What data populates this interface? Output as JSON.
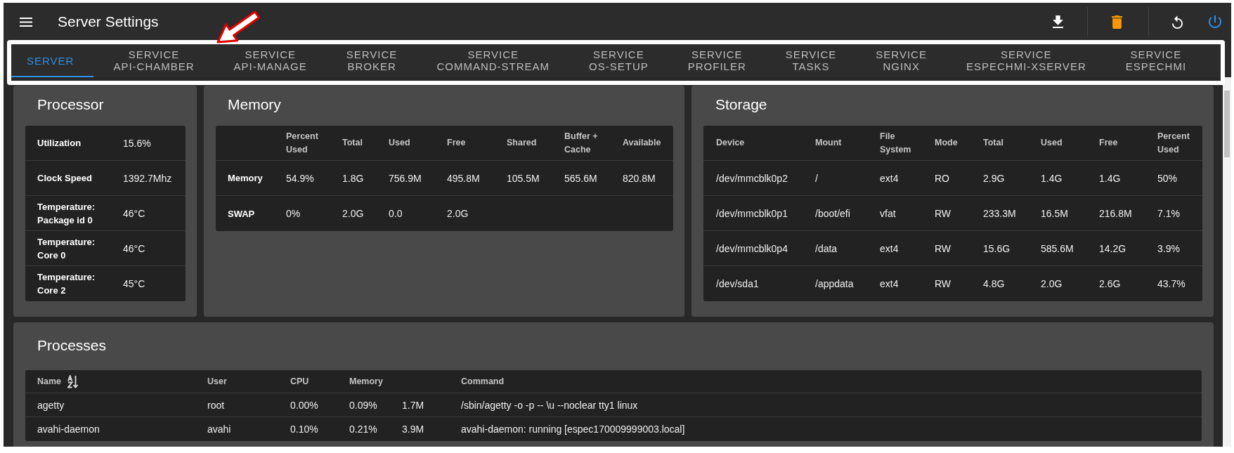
{
  "app_bar": {
    "title": "Server Settings"
  },
  "tabs": [
    {
      "label": "SERVER",
      "selected": true
    },
    {
      "label": "SERVICE\nAPI-CHAMBER",
      "selected": false
    },
    {
      "label": "SERVICE\nAPI-MANAGE",
      "selected": false
    },
    {
      "label": "SERVICE\nBROKER",
      "selected": false
    },
    {
      "label": "SERVICE\nCOMMAND-STREAM",
      "selected": false
    },
    {
      "label": "SERVICE\nOS-SETUP",
      "selected": false
    },
    {
      "label": "SERVICE\nPROFILER",
      "selected": false
    },
    {
      "label": "SERVICE\nTASKS",
      "selected": false
    },
    {
      "label": "SERVICE\nNGINX",
      "selected": false
    },
    {
      "label": "SERVICE\nESPECHMI-XSERVER",
      "selected": false
    },
    {
      "label": "SERVICE\nESPECHMI",
      "selected": false
    }
  ],
  "processor": {
    "title": "Processor",
    "rows": [
      {
        "label": "Utilization",
        "value": "15.6%"
      },
      {
        "label": "Clock Speed",
        "value": "1392.7Mhz"
      },
      {
        "label": "Temperature: Package id 0",
        "value": "46°C"
      },
      {
        "label": "Temperature: Core 0",
        "value": "46°C"
      },
      {
        "label": "Temperature: Core 2",
        "value": "45°C"
      }
    ]
  },
  "memory": {
    "title": "Memory",
    "columns": [
      "Percent Used",
      "Total",
      "Used",
      "Free",
      "Shared",
      "Buffer + Cache",
      "Available"
    ],
    "rows": [
      {
        "label": "Memory",
        "values": [
          "54.9%",
          "1.8G",
          "756.9M",
          "495.8M",
          "105.5M",
          "565.6M",
          "820.8M"
        ]
      },
      {
        "label": "SWAP",
        "values": [
          "0%",
          "2.0G",
          "0.0",
          "2.0G"
        ]
      }
    ]
  },
  "storage": {
    "title": "Storage",
    "columns": [
      "Device",
      "Mount",
      "File System",
      "Mode",
      "Total",
      "Used",
      "Free",
      "Percent Used"
    ],
    "rows": [
      {
        "cells": [
          "/dev/mmcblk0p2",
          "/",
          "ext4",
          "RO",
          "2.9G",
          "1.4G",
          "1.4G",
          "50%"
        ]
      },
      {
        "cells": [
          "/dev/mmcblk0p1",
          "/boot/efi",
          "vfat",
          "RW",
          "233.3M",
          "16.5M",
          "216.8M",
          "7.1%"
        ]
      },
      {
        "cells": [
          "/dev/mmcblk0p4",
          "/data",
          "ext4",
          "RW",
          "15.6G",
          "585.6M",
          "14.2G",
          "3.9%"
        ]
      },
      {
        "cells": [
          "/dev/sda1",
          "/appdata",
          "ext4",
          "RW",
          "4.8G",
          "2.0G",
          "2.6G",
          "43.7%"
        ]
      }
    ]
  },
  "processes": {
    "title": "Processes",
    "columns": [
      {
        "label": "Name",
        "sorted": true
      },
      {
        "label": "User",
        "sorted": false
      },
      {
        "label": "CPU",
        "sorted": false
      },
      {
        "label": "Memory",
        "sorted": false
      },
      {
        "label": "Command",
        "sorted": false
      }
    ],
    "rows": [
      {
        "cells": [
          "agetty",
          "root",
          "0.00%",
          [
            "0.09%",
            "1.7M"
          ],
          "/sbin/agetty -o -p -- \\u --noclear tty1 linux"
        ]
      },
      {
        "cells": [
          "avahi-daemon",
          "avahi",
          "0.10%",
          [
            "0.21%",
            "3.9M"
          ],
          "avahi-daemon: running [espec170009999003.local]"
        ]
      }
    ]
  }
}
